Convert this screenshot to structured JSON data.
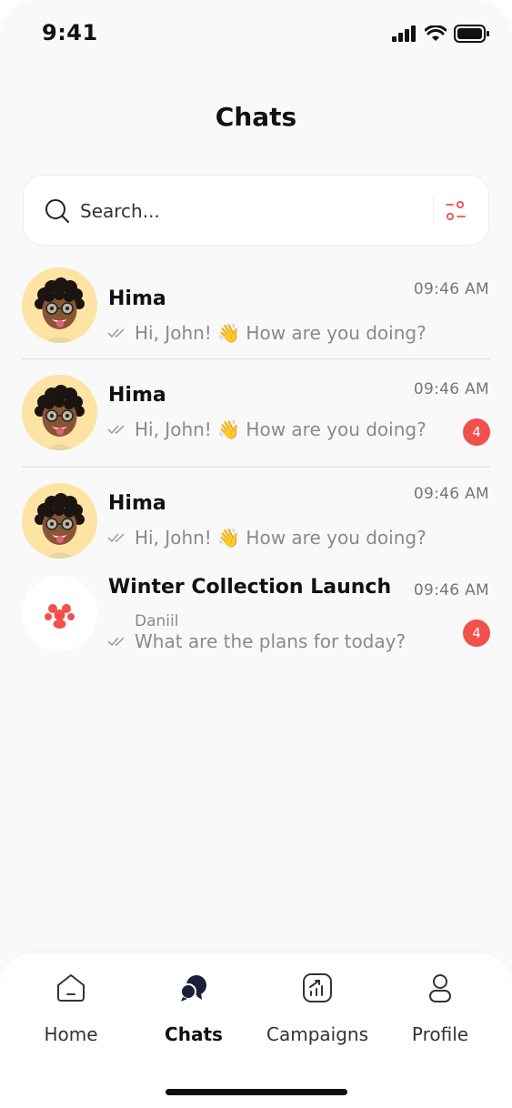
{
  "status_bar": {
    "time": "9:41"
  },
  "header": {
    "title": "Chats"
  },
  "search": {
    "placeholder": "Search..."
  },
  "chats": [
    {
      "name": "Hima",
      "time": "09:46 AM",
      "message": "Hi, John! 👋 How are you doing?",
      "unread": ""
    },
    {
      "name": "Hima",
      "time": "09:46 AM",
      "message": "Hi, John! 👋 How are you doing?",
      "unread": "4"
    },
    {
      "name": "Hima",
      "time": "09:46 AM",
      "message": "Hi, John! 👋 How are you doing?",
      "unread": ""
    },
    {
      "name": "Winter Collection Launch",
      "time": "09:46 AM",
      "sender": "Daniil",
      "message": "What are the plans for today?",
      "unread": "4"
    }
  ],
  "tabs": [
    {
      "label": "Home",
      "icon": "home-icon",
      "active": false
    },
    {
      "label": "Chats",
      "icon": "chats-icon",
      "active": true
    },
    {
      "label": "Campaigns",
      "icon": "campaigns-icon",
      "active": false
    },
    {
      "label": "Profile",
      "icon": "profile-icon",
      "active": false
    }
  ],
  "colors": {
    "accent": "#f2504b",
    "avatar_bg": "#fde4a5",
    "active_icon": "#1a1f3a",
    "divider": "#cfe0f5"
  }
}
